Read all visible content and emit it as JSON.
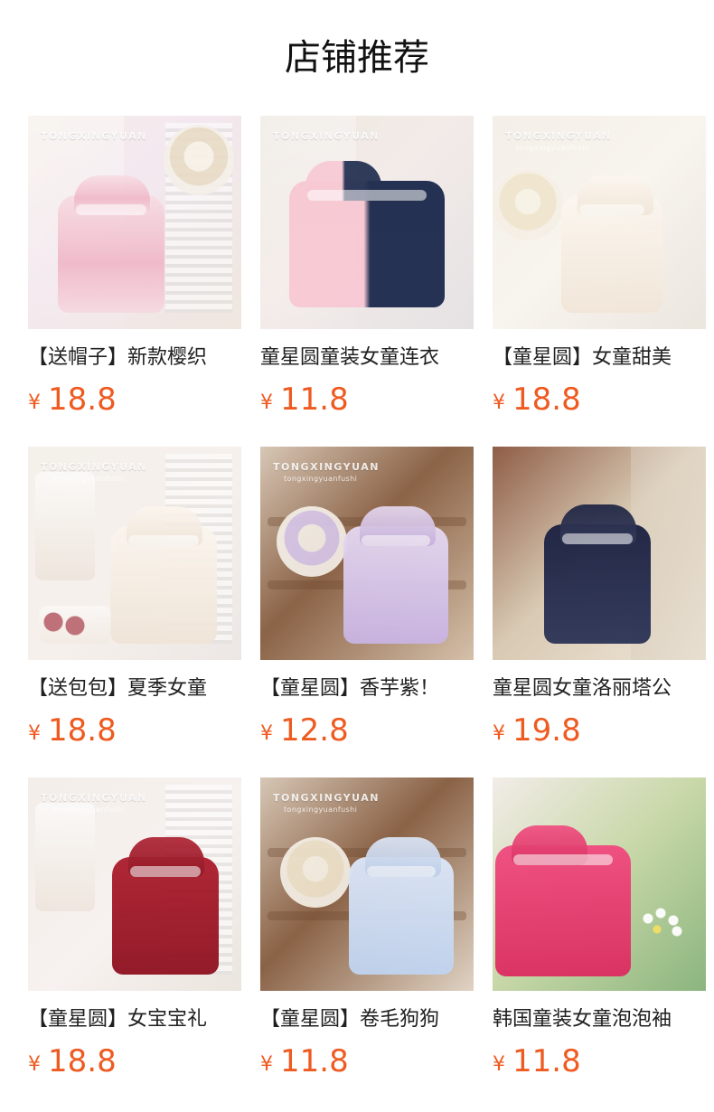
{
  "header": {
    "title": "店铺推荐"
  },
  "products": [
    {
      "name": "【送帽子】新款樱织",
      "currency": "¥",
      "price": "18.8",
      "brand": "TONGXINGYUAN",
      "sub": ""
    },
    {
      "name": "童星圆童装女童连衣",
      "currency": "¥",
      "price": "11.8",
      "brand": "TONGXINGYUAN",
      "sub": ""
    },
    {
      "name": "【童星圆】女童甜美",
      "currency": "¥",
      "price": "18.8",
      "brand": "TONGXINGYUAN",
      "sub": "tongxingyuanfushi"
    },
    {
      "name": "【送包包】夏季女童",
      "currency": "¥",
      "price": "18.8",
      "brand": "TONGXINGYUAN",
      "sub": "tongxingyuanfushi"
    },
    {
      "name": "【童星圆】香芋紫！",
      "currency": "¥",
      "price": "12.8",
      "brand": "TONGXINGYUAN",
      "sub": "tongxingyuanfushi"
    },
    {
      "name": "童星圆女童洛丽塔公",
      "currency": "¥",
      "price": "19.8",
      "brand": "",
      "sub": ""
    },
    {
      "name": "【童星圆】女宝宝礼",
      "currency": "¥",
      "price": "18.8",
      "brand": "TONGXINGYUAN",
      "sub": "tongxingyuanfushi"
    },
    {
      "name": "【童星圆】卷毛狗狗",
      "currency": "¥",
      "price": "11.8",
      "brand": "TONGXINGYUAN",
      "sub": "tongxingyuanfushi"
    },
    {
      "name": "韩国童装女童泡泡袖",
      "currency": "¥",
      "price": "11.8",
      "brand": "",
      "sub": ""
    }
  ]
}
